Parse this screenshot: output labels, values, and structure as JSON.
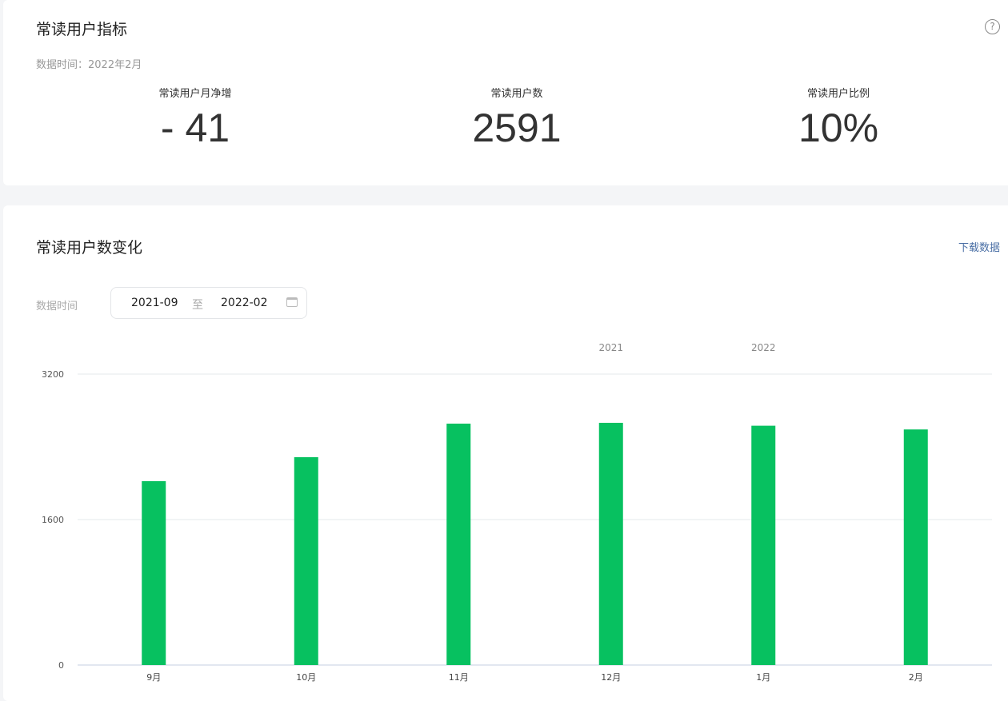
{
  "overview": {
    "title": "常读用户指标",
    "data_time": "数据时间：2022年2月",
    "help_icon": "?",
    "metrics": [
      {
        "label": "常读用户月净增",
        "value": "- 41"
      },
      {
        "label": "常读用户数",
        "value": "2591"
      },
      {
        "label": "常读用户比例",
        "value": "10%"
      }
    ]
  },
  "trend": {
    "title": "常读用户数变化",
    "download": "下载数据",
    "date_label": "数据时间",
    "start": "2021-09",
    "sep": "至",
    "end": "2022-02"
  },
  "chart_data": {
    "type": "bar",
    "categories": [
      "9月",
      "10月",
      "11月",
      "12月",
      "1月",
      "2月"
    ],
    "values": [
      2022,
      2286,
      2655,
      2664,
      2632,
      2591
    ],
    "year_labels": [
      {
        "text": "2021",
        "category": "12月"
      },
      {
        "text": "2022",
        "category": "1月"
      }
    ],
    "yticks": [
      "0",
      "1600",
      "3200"
    ],
    "ylim": [
      0,
      3200
    ],
    "color": "#07c160"
  }
}
